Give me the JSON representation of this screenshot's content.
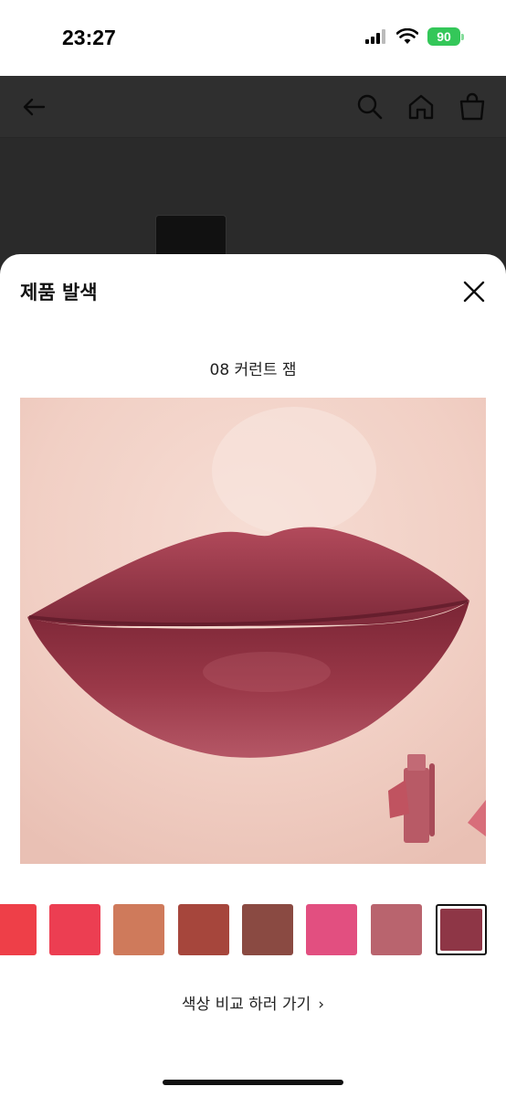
{
  "status_bar": {
    "time": "23:27",
    "battery": "90"
  },
  "header": {
    "back_icon": "arrow-left-icon",
    "search_icon": "search-icon",
    "home_icon": "home-icon",
    "cart_icon": "shopping-bag-icon"
  },
  "sheet": {
    "title": "제품 발색",
    "shade_name": "08 커런트 잼",
    "compare_label": "색상 비교 하러 가기",
    "compare_chevron": "›",
    "swatches": [
      {
        "color": "#ee3f48"
      },
      {
        "color": "#ec3e52"
      },
      {
        "color": "#cf7a5b"
      },
      {
        "color": "#a6463c"
      },
      {
        "color": "#8a4a42"
      },
      {
        "color": "#e24f80"
      },
      {
        "color": "#b9646e"
      },
      {
        "color": "#8e3646",
        "selected": true
      }
    ]
  },
  "colors": {
    "accent_lip": "#9c3a4c",
    "sheet_bg": "#ffffff",
    "overlay": "#2c2c2c"
  }
}
